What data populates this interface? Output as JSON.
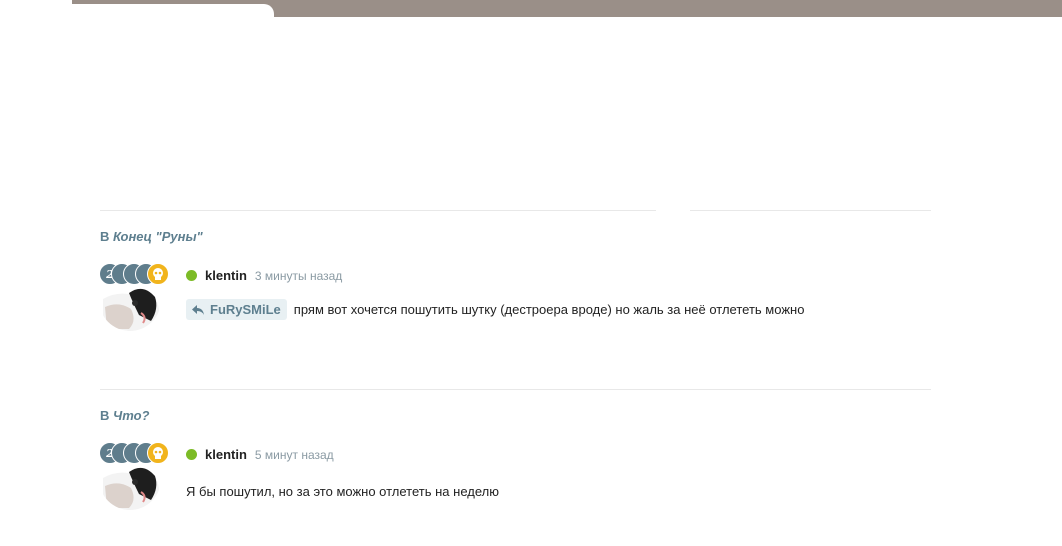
{
  "threads": [
    {
      "prefix": "В ",
      "topic": "Конец \"Руны\"",
      "comment": {
        "user": "klentin",
        "time": "3 минуты назад",
        "reply_to": "FuRySMiLe",
        "text": "прям вот хочется пошутить шутку (дестроера вроде) но жаль за неё отлететь можно",
        "badge_level": "2"
      }
    },
    {
      "prefix": "В ",
      "topic": "Что?",
      "comment": {
        "user": "klentin",
        "time": "5 минут назад",
        "text": "Я бы пошутил, но за это можно отлететь на неделю",
        "badge_level": "2"
      }
    }
  ],
  "colors": {
    "accent": "#5e7f8f",
    "online": "#7cbb26",
    "badge_gold": "#f1b41c",
    "topbar": "#9a8f88"
  }
}
